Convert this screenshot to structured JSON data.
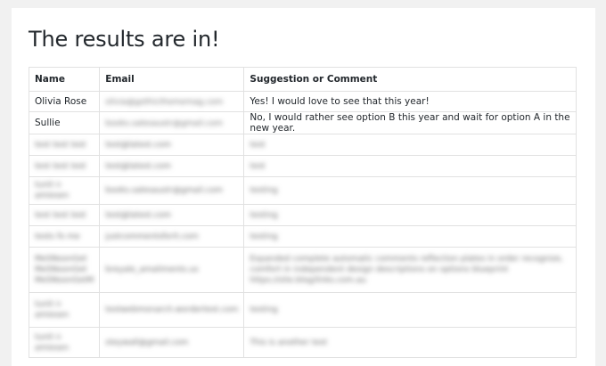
{
  "page": {
    "title": "The results are in!"
  },
  "table": {
    "headers": [
      "Name",
      "Email",
      "Suggestion or Comment"
    ],
    "rows": [
      {
        "name": "Olivia Rose",
        "email": "olivia@gothicthememag.com",
        "comment": "Yes! I would love to see that this year!"
      },
      {
        "name": "Sullie",
        "email": "books.salesaustr@gmail.com",
        "comment": "No, I would rather see option B this year and wait for option A in the new year."
      },
      {
        "name": "test test test",
        "email": "test@latest.com",
        "comment": "test"
      },
      {
        "name": "test test test",
        "email": "test@latest.com",
        "comment": "test"
      },
      {
        "name": "tunit n amiesen",
        "email": "books.salesaustr@gmail.com",
        "comment": "testing"
      },
      {
        "name": "test test test",
        "email": "test@latest.com",
        "comment": "testing"
      },
      {
        "name": "tests fo me",
        "email": "justcommentsforit.com",
        "comment": "testing"
      },
      {
        "name": "MeSNoonGet MeSNoonGet MeSNoonGetM",
        "email": "breyale_amaliments.us",
        "comment": "Expanded complete automatic comments reflection plates in order recognize, comfort in independent design descriptions on options blueprint https://site.blog/links.com.au"
      },
      {
        "name": "tunit n amiesen",
        "email": "testwebmonarch.wordertest.com",
        "comment": "testing"
      },
      {
        "name": "tunit n amiesen",
        "email": "steywall@gmail.com",
        "comment": "This is another test"
      }
    ]
  }
}
